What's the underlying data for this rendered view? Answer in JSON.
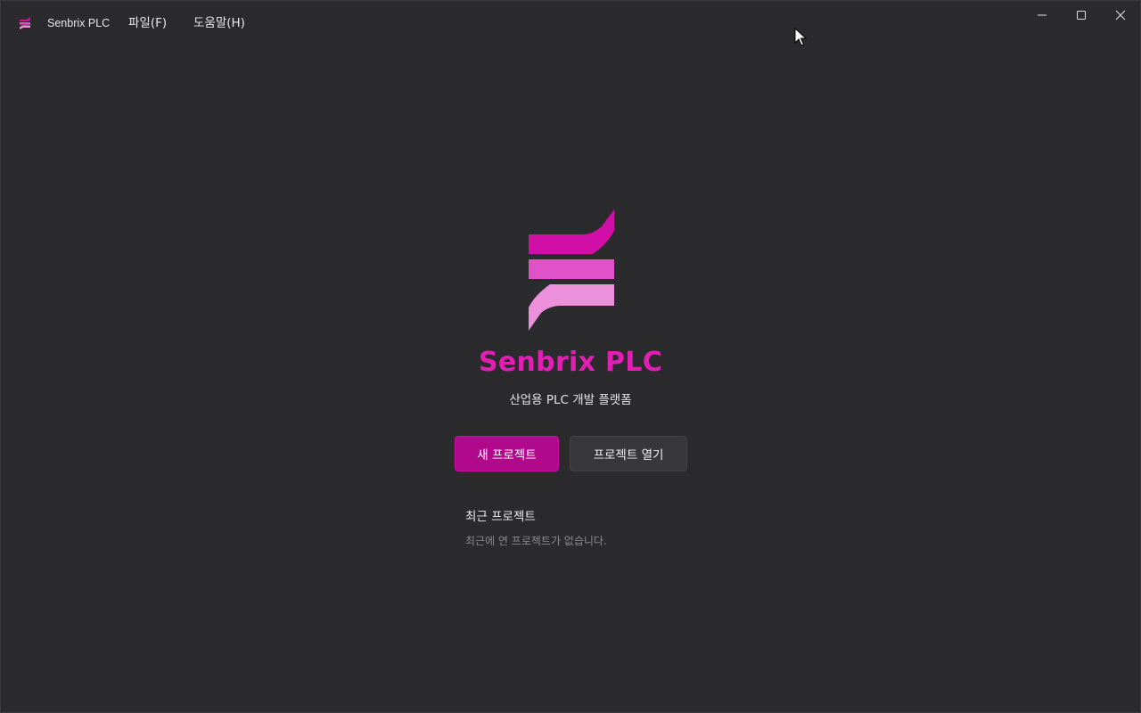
{
  "window": {
    "title": "Senbrix PLC",
    "controls": {
      "minimize": "minimize-icon",
      "maximize": "maximize-icon",
      "close": "close-icon"
    }
  },
  "menu": {
    "file": "파일(F)",
    "help": "도움말(H)"
  },
  "welcome": {
    "brand": "Senbrix PLC",
    "subtitle": "산업용 PLC 개발 플랫폼",
    "new_project": "새 프로젝트",
    "open_project": "프로젝트 열기"
  },
  "recent": {
    "title": "최근 프로젝트",
    "empty_message": "최근에 연 프로젝트가 없습니다."
  },
  "colors": {
    "background": "#2b2b2e",
    "brand": "#e11fb4",
    "primary_button": "#b0098c",
    "logo_top": "#d10fa6",
    "logo_mid": "#e052c8",
    "logo_bottom": "#ec90dc"
  }
}
